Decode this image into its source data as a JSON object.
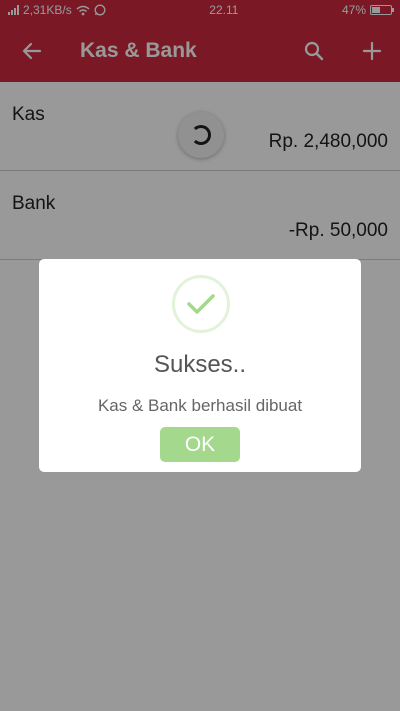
{
  "status_bar": {
    "network_speed": "2,31KB/s",
    "time": "22.11",
    "battery": "47%",
    "battery_level": 0.47
  },
  "app_bar": {
    "title": "Kas & Bank",
    "back_icon": "arrow-left-icon",
    "search_icon": "search-icon",
    "add_icon": "plus-icon",
    "color": "#cc2b3e"
  },
  "accounts": [
    {
      "name": "Kas",
      "amount": "Rp. 2,480,000"
    },
    {
      "name": "Bank",
      "amount": "-Rp. 50,000"
    }
  ],
  "dialog": {
    "title": "Sukses..",
    "message": "Kas & Bank berhasil dibuat",
    "button_label": "OK",
    "icon": "check-icon",
    "button_color": "#a4d98d"
  }
}
